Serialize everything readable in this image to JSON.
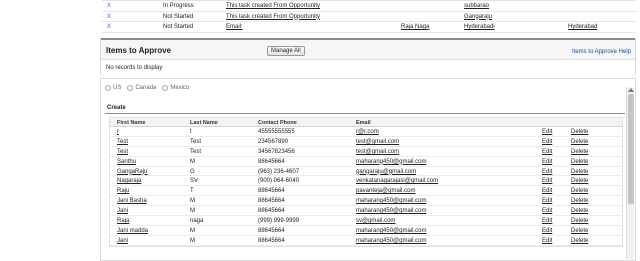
{
  "tasks": [
    {
      "x": "X",
      "status": "In Progress",
      "subject": "This task created From Opportunity",
      "who": "",
      "what": "subbarao",
      "location": ""
    },
    {
      "x": "X",
      "status": "Not Started",
      "subject": "This task created From Opportunity",
      "who": "",
      "what": "Gangaraju",
      "location": ""
    },
    {
      "x": "X",
      "status": "Not Started",
      "subject": "Email:",
      "who": "Raja Naga",
      "what": "Hyderabadi",
      "location": "Hyderabad"
    }
  ],
  "approve": {
    "title": "Items to Approve",
    "manage_button": "Manage All",
    "help_link": "Items to Approve Help",
    "empty_text": "No records to display"
  },
  "radios": [
    {
      "label": "US"
    },
    {
      "label": "Canada"
    },
    {
      "label": "Mexico"
    }
  ],
  "create_label": "Create",
  "columns": {
    "first": "First Name",
    "last": "Last Name",
    "phone": "Contact Phone",
    "email": "Email"
  },
  "contacts": [
    {
      "first": "r",
      "last": "t",
      "phone": "45555555555",
      "email": "r@r.com",
      "edit": "Edit",
      "del": "Delete"
    },
    {
      "first": "Test",
      "last": "Test",
      "phone": "234567890",
      "email": "test@gmail.com",
      "edit": "Edit",
      "del": "Delete"
    },
    {
      "first": "Test",
      "last": "Test",
      "phone": "34567823456",
      "email": "test@gmail.com",
      "edit": "Edit",
      "del": "Delete"
    },
    {
      "first": "Santhu",
      "last": "M",
      "phone": "88645664",
      "email": "maharang450@gmail.com",
      "edit": "Edit",
      "del": "Delete"
    },
    {
      "first": "GangaRaju",
      "last": "G",
      "phone": "(963) 236-4607",
      "email": "gangaraju@gmail.com",
      "edit": "Edit",
      "del": "Delete"
    },
    {
      "first": "Nagaraja",
      "last": "SV",
      "phone": "(900) 064-6040",
      "email": "venkatanagarajasi@gmail.com",
      "edit": "Edit",
      "del": "Delete"
    },
    {
      "first": "Raju",
      "last": "T",
      "phone": "88645664",
      "email": "pavanteja@gmail.com",
      "edit": "Edit",
      "del": "Delete"
    },
    {
      "first": "Jani Basha",
      "last": "M",
      "phone": "88645664",
      "email": "maharang450@gmail.com",
      "edit": "Edit",
      "del": "Delete"
    },
    {
      "first": "Jani",
      "last": "M",
      "phone": "88645664",
      "email": "maharang450@gmail.com",
      "edit": "Edit",
      "del": "Delete"
    },
    {
      "first": "Raja",
      "last": "naga",
      "phone": "(999) 999-9999",
      "email": "sv@gmail.com",
      "edit": "Edit",
      "del": "Delete"
    },
    {
      "first": "Jani madda",
      "last": "M",
      "phone": "88645664",
      "email": "maharang450@gmail.com",
      "edit": "Edit",
      "del": "Delete"
    },
    {
      "first": "Jani",
      "last": "M",
      "phone": "88645664",
      "email": "maharang450@gmail.com",
      "edit": "Edit",
      "del": "Delete"
    }
  ]
}
